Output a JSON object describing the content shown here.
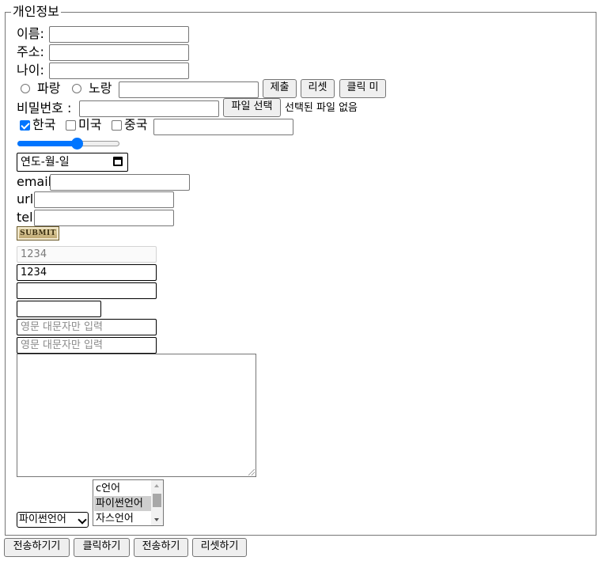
{
  "legend": "개인정보",
  "name": {
    "label": "이름:",
    "value": ""
  },
  "address": {
    "label": "주소:",
    "value": ""
  },
  "age": {
    "label": "나이:",
    "value": ""
  },
  "color": {
    "options": [
      "파랑",
      "노랑"
    ],
    "text_value": "",
    "submit_label": "제출",
    "reset_label": "리셋",
    "button_label": "클릭 미"
  },
  "password": {
    "label": "비밀번호 :",
    "value": "",
    "file_button": "파일 선택",
    "file_status": "선택된 파일 없음"
  },
  "country": {
    "options": [
      {
        "label": "한국",
        "checked": true
      },
      {
        "label": "미국",
        "checked": false
      },
      {
        "label": "중국",
        "checked": false
      }
    ],
    "text_value": ""
  },
  "range": {
    "value": 0.6
  },
  "date": {
    "placeholder": "연도-월-일"
  },
  "email": {
    "label": "email:",
    "value": ""
  },
  "url": {
    "label": "url:",
    "value": ""
  },
  "tel": {
    "label": "tel:",
    "value": ""
  },
  "image_submit": {
    "text": "SUBMIT"
  },
  "inputs": {
    "disabled_value": "1234",
    "readonly_value": "1234",
    "empty1": "",
    "empty2": "",
    "pattern_placeholder1": "영문 대문자만 입력",
    "pattern_placeholder2": "영문 대문자만 입력"
  },
  "textarea": {
    "value": ""
  },
  "dropdown": {
    "selected": "파이썬언어"
  },
  "listbox": {
    "options": [
      "c언어",
      "파이썬언어",
      "자스언어"
    ],
    "selected_index": 1
  },
  "footer_buttons": [
    "전송하기기",
    "클릭하기",
    "전송하기",
    "리셋하기"
  ]
}
